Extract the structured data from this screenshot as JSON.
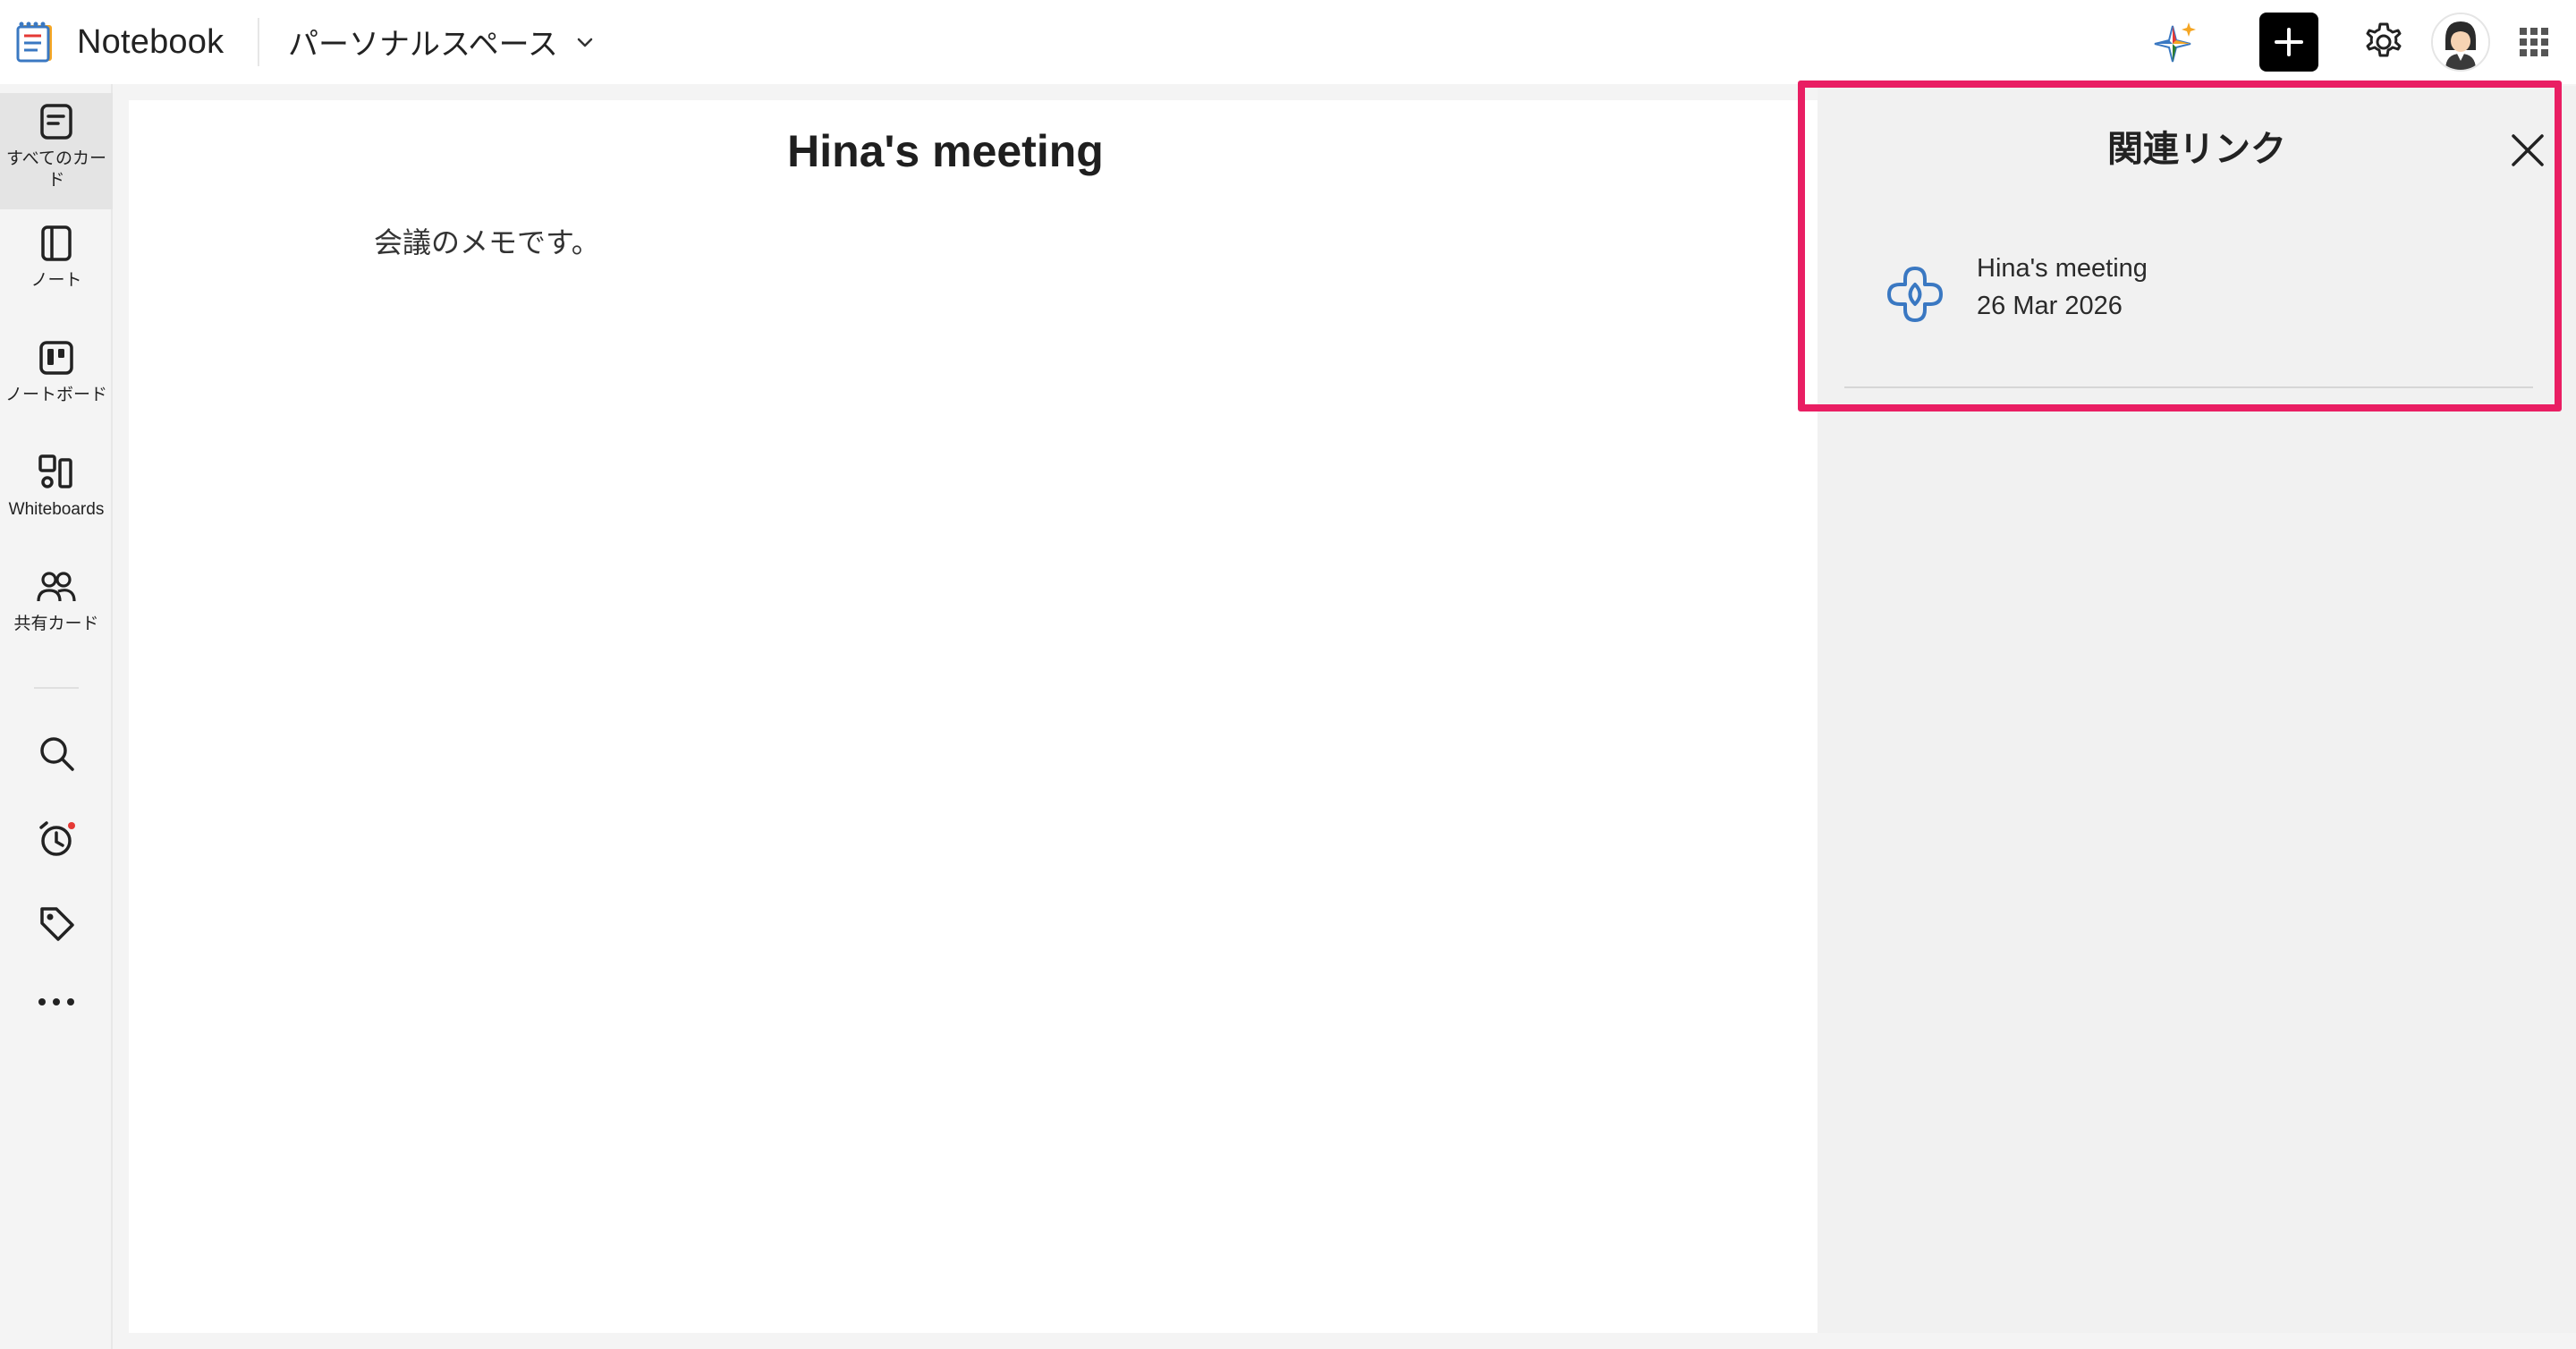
{
  "app": {
    "name": "Notebook",
    "space_name": "パーソナルスペース"
  },
  "leftnav": {
    "items": [
      {
        "label": "すべてのカード",
        "icon": "all-cards-icon",
        "active": true
      },
      {
        "label": "ノート",
        "icon": "notebook-icon"
      },
      {
        "label": "ノートボード",
        "icon": "noteboard-icon"
      },
      {
        "label": "Whiteboards",
        "icon": "whiteboard-icon"
      },
      {
        "label": "共有カード",
        "icon": "shared-people-icon"
      }
    ],
    "tools": [
      "search-icon",
      "reminder-icon",
      "tag-icon",
      "more-icon"
    ]
  },
  "note": {
    "title": "Hina's meeting",
    "body": "会議のメモです。"
  },
  "related_panel": {
    "title": "関連リンク",
    "items": [
      {
        "title": "Hina's meeting",
        "date": "26 Mar 2026",
        "icon": "meeting-link-icon"
      }
    ]
  },
  "colors": {
    "highlight": "#e91e63",
    "link_icon": "#3a78c2",
    "background": "#f4f4f4"
  }
}
